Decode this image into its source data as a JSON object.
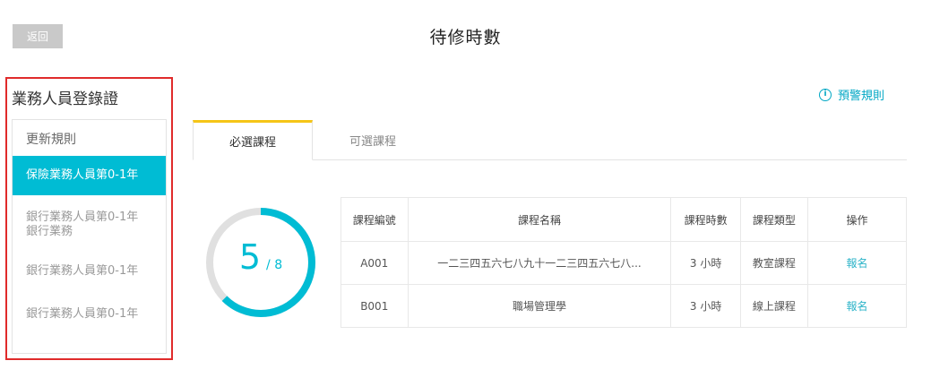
{
  "header": {
    "back_label": "返回",
    "title": "待修時數"
  },
  "sidebar": {
    "heading": "業務人員登錄證",
    "items": [
      {
        "label": "更新規則"
      },
      {
        "label": "保險業務人員第0-1年",
        "active": true
      },
      {
        "label": "銀行業務人員第0-1年",
        "sublabel": "銀行業務"
      },
      {
        "label": "銀行業務人員第0-1年"
      },
      {
        "label": "銀行業務人員第0-1年"
      }
    ]
  },
  "rules_link": {
    "icon": "info-icon",
    "label": "預警規則"
  },
  "tabs": [
    {
      "label": "必選課程",
      "active": true
    },
    {
      "label": "可選課程",
      "active": false
    }
  ],
  "progress": {
    "value": "5",
    "total": "/ 8",
    "fraction": 0.625,
    "color": "#00bcd4",
    "track_color": "#e0e0e0"
  },
  "table": {
    "headers": {
      "id": "課程編號",
      "name": "課程名稱",
      "hours": "課程時數",
      "type": "課程類型",
      "op": "操作"
    },
    "rows": [
      {
        "id": "A001",
        "name": "一二三四五六七八九十一二三四五六七八...",
        "hours": "3 小時",
        "type": "教室課程",
        "op": "報名"
      },
      {
        "id": "B001",
        "name": "職場管理學",
        "hours": "3 小時",
        "type": "線上課程",
        "op": "報名"
      }
    ]
  },
  "colors": {
    "accent": "#00bcd4",
    "tab_indicator": "#f5c518",
    "highlight_border": "#e02b2b"
  }
}
